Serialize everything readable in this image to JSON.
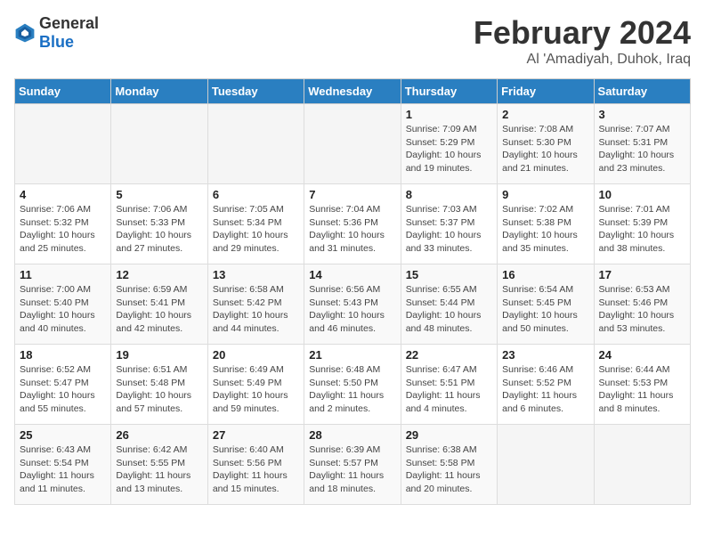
{
  "logo": {
    "text_general": "General",
    "text_blue": "Blue"
  },
  "title": "February 2024",
  "subtitle": "Al 'Amadiyah, Duhok, Iraq",
  "days_of_week": [
    "Sunday",
    "Monday",
    "Tuesday",
    "Wednesday",
    "Thursday",
    "Friday",
    "Saturday"
  ],
  "weeks": [
    [
      {
        "day": "",
        "info": ""
      },
      {
        "day": "",
        "info": ""
      },
      {
        "day": "",
        "info": ""
      },
      {
        "day": "",
        "info": ""
      },
      {
        "day": "1",
        "info": "Sunrise: 7:09 AM\nSunset: 5:29 PM\nDaylight: 10 hours\nand 19 minutes."
      },
      {
        "day": "2",
        "info": "Sunrise: 7:08 AM\nSunset: 5:30 PM\nDaylight: 10 hours\nand 21 minutes."
      },
      {
        "day": "3",
        "info": "Sunrise: 7:07 AM\nSunset: 5:31 PM\nDaylight: 10 hours\nand 23 minutes."
      }
    ],
    [
      {
        "day": "4",
        "info": "Sunrise: 7:06 AM\nSunset: 5:32 PM\nDaylight: 10 hours\nand 25 minutes."
      },
      {
        "day": "5",
        "info": "Sunrise: 7:06 AM\nSunset: 5:33 PM\nDaylight: 10 hours\nand 27 minutes."
      },
      {
        "day": "6",
        "info": "Sunrise: 7:05 AM\nSunset: 5:34 PM\nDaylight: 10 hours\nand 29 minutes."
      },
      {
        "day": "7",
        "info": "Sunrise: 7:04 AM\nSunset: 5:36 PM\nDaylight: 10 hours\nand 31 minutes."
      },
      {
        "day": "8",
        "info": "Sunrise: 7:03 AM\nSunset: 5:37 PM\nDaylight: 10 hours\nand 33 minutes."
      },
      {
        "day": "9",
        "info": "Sunrise: 7:02 AM\nSunset: 5:38 PM\nDaylight: 10 hours\nand 35 minutes."
      },
      {
        "day": "10",
        "info": "Sunrise: 7:01 AM\nSunset: 5:39 PM\nDaylight: 10 hours\nand 38 minutes."
      }
    ],
    [
      {
        "day": "11",
        "info": "Sunrise: 7:00 AM\nSunset: 5:40 PM\nDaylight: 10 hours\nand 40 minutes."
      },
      {
        "day": "12",
        "info": "Sunrise: 6:59 AM\nSunset: 5:41 PM\nDaylight: 10 hours\nand 42 minutes."
      },
      {
        "day": "13",
        "info": "Sunrise: 6:58 AM\nSunset: 5:42 PM\nDaylight: 10 hours\nand 44 minutes."
      },
      {
        "day": "14",
        "info": "Sunrise: 6:56 AM\nSunset: 5:43 PM\nDaylight: 10 hours\nand 46 minutes."
      },
      {
        "day": "15",
        "info": "Sunrise: 6:55 AM\nSunset: 5:44 PM\nDaylight: 10 hours\nand 48 minutes."
      },
      {
        "day": "16",
        "info": "Sunrise: 6:54 AM\nSunset: 5:45 PM\nDaylight: 10 hours\nand 50 minutes."
      },
      {
        "day": "17",
        "info": "Sunrise: 6:53 AM\nSunset: 5:46 PM\nDaylight: 10 hours\nand 53 minutes."
      }
    ],
    [
      {
        "day": "18",
        "info": "Sunrise: 6:52 AM\nSunset: 5:47 PM\nDaylight: 10 hours\nand 55 minutes."
      },
      {
        "day": "19",
        "info": "Sunrise: 6:51 AM\nSunset: 5:48 PM\nDaylight: 10 hours\nand 57 minutes."
      },
      {
        "day": "20",
        "info": "Sunrise: 6:49 AM\nSunset: 5:49 PM\nDaylight: 10 hours\nand 59 minutes."
      },
      {
        "day": "21",
        "info": "Sunrise: 6:48 AM\nSunset: 5:50 PM\nDaylight: 11 hours\nand 2 minutes."
      },
      {
        "day": "22",
        "info": "Sunrise: 6:47 AM\nSunset: 5:51 PM\nDaylight: 11 hours\nand 4 minutes."
      },
      {
        "day": "23",
        "info": "Sunrise: 6:46 AM\nSunset: 5:52 PM\nDaylight: 11 hours\nand 6 minutes."
      },
      {
        "day": "24",
        "info": "Sunrise: 6:44 AM\nSunset: 5:53 PM\nDaylight: 11 hours\nand 8 minutes."
      }
    ],
    [
      {
        "day": "25",
        "info": "Sunrise: 6:43 AM\nSunset: 5:54 PM\nDaylight: 11 hours\nand 11 minutes."
      },
      {
        "day": "26",
        "info": "Sunrise: 6:42 AM\nSunset: 5:55 PM\nDaylight: 11 hours\nand 13 minutes."
      },
      {
        "day": "27",
        "info": "Sunrise: 6:40 AM\nSunset: 5:56 PM\nDaylight: 11 hours\nand 15 minutes."
      },
      {
        "day": "28",
        "info": "Sunrise: 6:39 AM\nSunset: 5:57 PM\nDaylight: 11 hours\nand 18 minutes."
      },
      {
        "day": "29",
        "info": "Sunrise: 6:38 AM\nSunset: 5:58 PM\nDaylight: 11 hours\nand 20 minutes."
      },
      {
        "day": "",
        "info": ""
      },
      {
        "day": "",
        "info": ""
      }
    ]
  ]
}
